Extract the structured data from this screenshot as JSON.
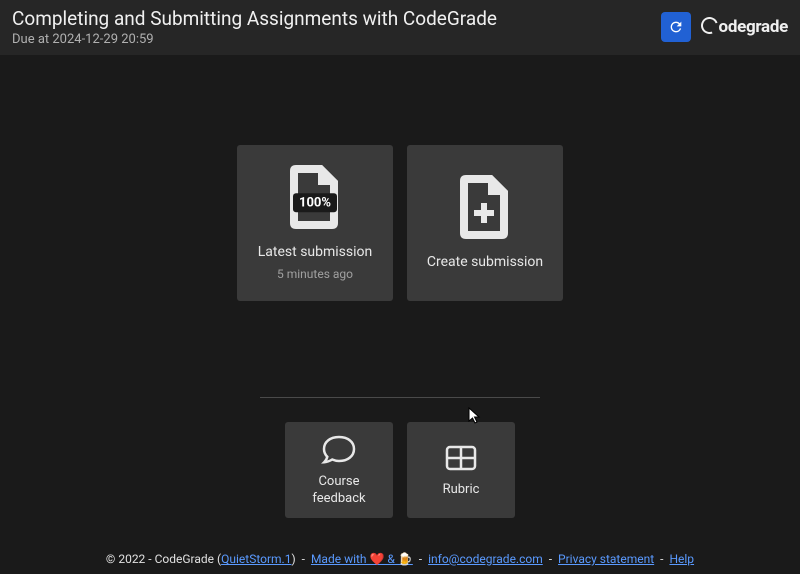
{
  "header": {
    "title": "Completing and Submitting Assignments with CodeGrade",
    "due_date": "Due at 2024-12-29 20:59",
    "logo_text": "odegrade"
  },
  "cards": {
    "latest_submission": {
      "label": "Latest submission",
      "sublabel": "5 minutes ago",
      "badge": "100%"
    },
    "create_submission": {
      "label": "Create submission"
    },
    "course_feedback": {
      "label": "Course feedback"
    },
    "rubric": {
      "label": "Rubric"
    }
  },
  "footer": {
    "copyright": "© 2022 - CodeGrade (",
    "version": "QuietStorm.1",
    "close_paren": ")",
    "made_with": "Made with ❤️ & 🍺",
    "email": "info@codegrade.com",
    "privacy": "Privacy statement",
    "help": "Help"
  }
}
